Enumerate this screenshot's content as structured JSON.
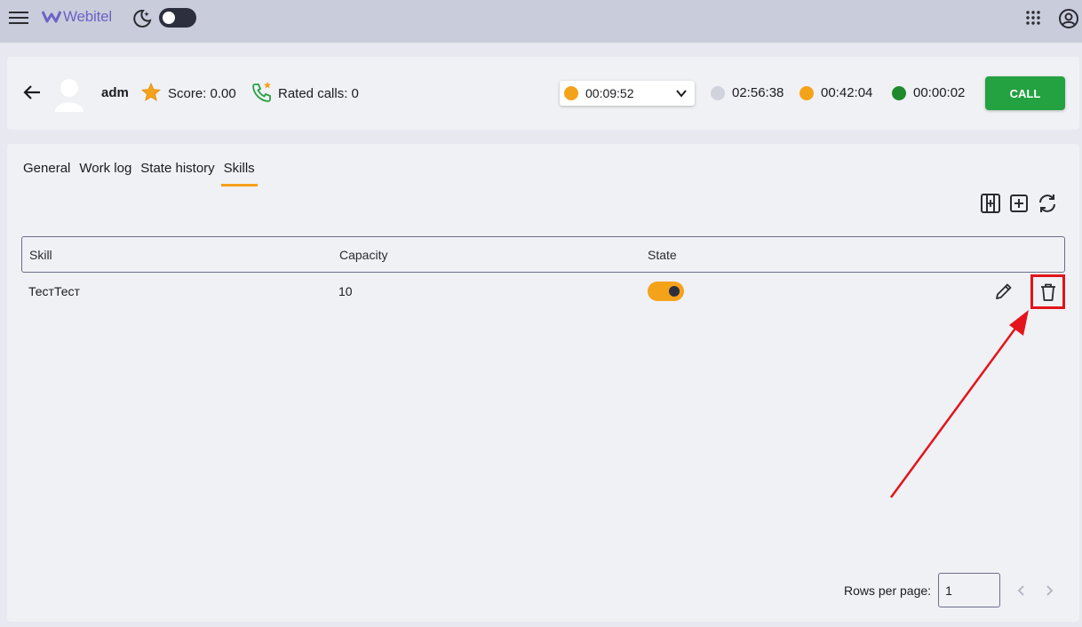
{
  "app": {
    "logo_text": "Webitel"
  },
  "agent": {
    "name": "adm",
    "score": "Score: 0.00",
    "rated_calls": "Rated calls: 0"
  },
  "status": {
    "current_time": "00:09:52",
    "current_color": "#f5a21b",
    "timers": [
      {
        "time": "02:56:38",
        "color": "#d0d2dc"
      },
      {
        "time": "00:42:04",
        "color": "#f5a21b"
      },
      {
        "time": "00:00:02",
        "color": "#1f8a2c"
      }
    ]
  },
  "call_button": {
    "label": "CALL"
  },
  "tabs": [
    {
      "label": "General"
    },
    {
      "label": "Work log"
    },
    {
      "label": "State history"
    },
    {
      "label": "Skills",
      "active": true
    }
  ],
  "table": {
    "headers": {
      "skill": "Skill",
      "capacity": "Capacity",
      "state": "State"
    },
    "rows": [
      {
        "skill": "ТестТест",
        "capacity": "10",
        "state_on": true
      }
    ]
  },
  "pagination": {
    "label": "Rows per page:",
    "value": "1"
  },
  "colors": {
    "accent": "#f5a21b",
    "call": "#24a141",
    "highlight": "#e3141b"
  }
}
